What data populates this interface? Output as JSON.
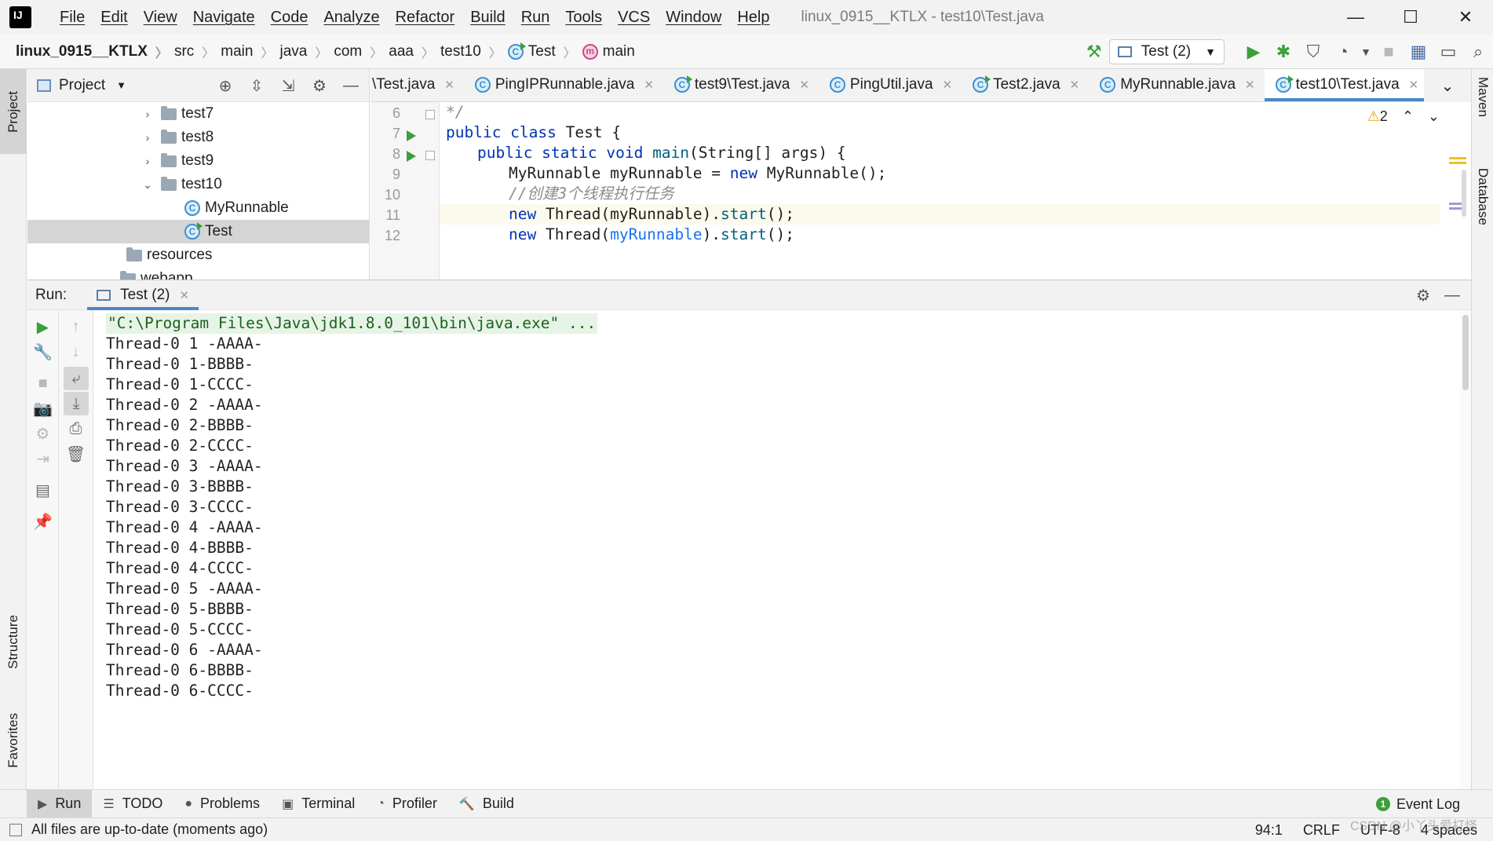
{
  "app": {
    "menu": [
      "File",
      "Edit",
      "View",
      "Navigate",
      "Code",
      "Analyze",
      "Refactor",
      "Build",
      "Run",
      "Tools",
      "VCS",
      "Window",
      "Help"
    ],
    "window_title": "linux_0915__KTLX - test10\\Test.java",
    "window_controls": {
      "minimize": "—",
      "maximize": "☐",
      "close": "✕"
    }
  },
  "breadcrumbs": [
    "linux_0915__KTLX",
    "src",
    "main",
    "java",
    "com",
    "aaa",
    "test10",
    "Test",
    "main"
  ],
  "run_config": {
    "label": "Test (2)"
  },
  "project_panel": {
    "title": "Project",
    "tree": [
      {
        "label": "test7",
        "arrow": "›"
      },
      {
        "label": "test8",
        "arrow": "›"
      },
      {
        "label": "test9",
        "arrow": "›"
      },
      {
        "label": "test10",
        "arrow": "⌄"
      },
      {
        "label": "MyRunnable"
      },
      {
        "label": "Test"
      },
      {
        "label": "resources"
      },
      {
        "label": "webapp"
      }
    ]
  },
  "editor": {
    "tabs": [
      {
        "label": "\\Test.java"
      },
      {
        "label": "PingIPRunnable.java"
      },
      {
        "label": "test9\\Test.java"
      },
      {
        "label": "PingUtil.java"
      },
      {
        "label": "Test2.java"
      },
      {
        "label": "MyRunnable.java"
      },
      {
        "label": "test10\\Test.java",
        "active": true
      }
    ],
    "warning_count": "2",
    "line_numbers": [
      "6",
      "7",
      "8",
      "9",
      "10",
      "11",
      "12"
    ],
    "code": {
      "l6": "*/",
      "l7_kw": "public class",
      "l7_rest": " Test {",
      "l8_kw": "public static void",
      "l8_md": " main",
      "l8_rest": "(String[] args) {",
      "l9_a": "MyRunnable myRunnable = ",
      "l9_kw": "new",
      "l9_b": " MyRunnable();",
      "l10": "//创建3个线程执行任务",
      "l11_kw": "new",
      "l11_a": " Thread(myRunnable).",
      "l11_md": "start",
      "l11_b": "();",
      "l12_kw": "new",
      "l12_a": " Thread(",
      "l12_fld": "myRunnable",
      "l12_b": ").",
      "l12_md": "start",
      "l12_c": "();"
    }
  },
  "run_window": {
    "label": "Run:",
    "tab": "Test (2)",
    "console": [
      "\"C:\\Program Files\\Java\\jdk1.8.0_101\\bin\\java.exe\" ...",
      "Thread-0 1 -AAAA-",
      "Thread-0 1-BBBB-",
      "Thread-0 1-CCCC-",
      "Thread-0 2 -AAAA-",
      "Thread-0 2-BBBB-",
      "Thread-0 2-CCCC-",
      "Thread-0 3 -AAAA-",
      "Thread-0 3-BBBB-",
      "Thread-0 3-CCCC-",
      "Thread-0 4 -AAAA-",
      "Thread-0 4-BBBB-",
      "Thread-0 4-CCCC-",
      "Thread-0 5 -AAAA-",
      "Thread-0 5-BBBB-",
      "Thread-0 5-CCCC-",
      "Thread-0 6 -AAAA-",
      "Thread-0 6-BBBB-",
      "Thread-0 6-CCCC-"
    ]
  },
  "side_tabs": {
    "left": [
      "Project",
      "Structure",
      "Favorites"
    ],
    "right": [
      "Maven",
      "Database"
    ]
  },
  "bottom_tools": [
    {
      "label": "Run",
      "icon": "▶"
    },
    {
      "label": "TODO",
      "icon": "☰"
    },
    {
      "label": "Problems",
      "icon": "●"
    },
    {
      "label": "Terminal",
      "icon": "▣"
    },
    {
      "label": "Profiler",
      "icon": "◔"
    },
    {
      "label": "Build",
      "icon": "🔨"
    }
  ],
  "event_log": {
    "label": "Event Log",
    "count": "1"
  },
  "status": {
    "message": "All files are up-to-date (moments ago)",
    "position": "94:1",
    "line_sep": "CRLF",
    "encoding": "UTF-8",
    "indent": "4 spaces",
    "watermark": "CSDN @小丫头爱打怪"
  },
  "colors": {
    "accent": "#4a88c7",
    "run_green": "#3b9f3b",
    "keyword": "#0033b3",
    "comment": "#8c8c8c"
  }
}
